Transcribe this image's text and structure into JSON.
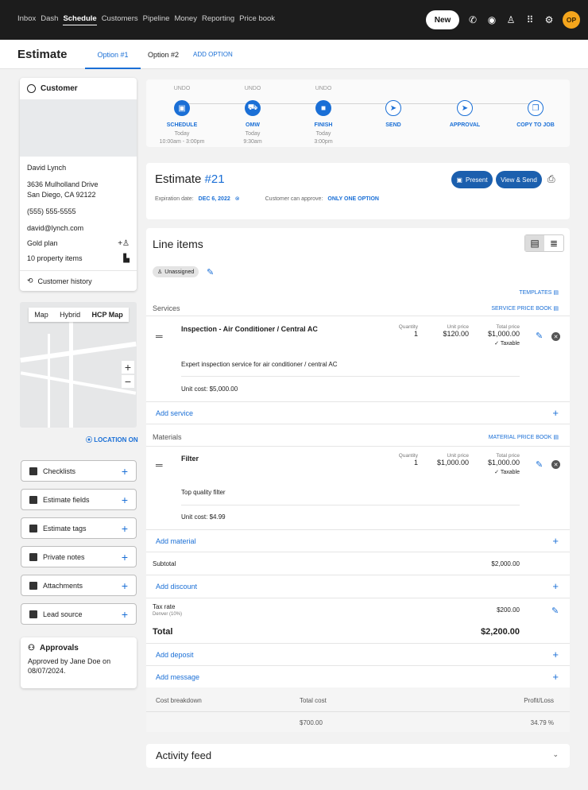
{
  "nav": {
    "links": [
      "Inbox",
      "Dash",
      "Schedule",
      "Customers",
      "Pipeline",
      "Money",
      "Reporting",
      "Price book"
    ],
    "active": "Schedule",
    "new_label": "New",
    "avatar": "OP",
    "icons": [
      "phone-icon",
      "chat-icon",
      "person-icon",
      "apps-grid-icon",
      "gear-icon"
    ]
  },
  "header": {
    "title": "Estimate",
    "tabs": [
      "Option #1",
      "Option #2"
    ],
    "add_option": "ADD OPTION"
  },
  "customer": {
    "heading": "Customer",
    "name": "David Lynch",
    "address1": "3636 Mulholland Drive",
    "address2": "San Diego, CA 92122",
    "phone": "(555) 555-5555",
    "email": "david@lynch.com",
    "plan": "Gold plan",
    "property": "10 property items",
    "history": "Customer history"
  },
  "map": {
    "tabs": [
      "Map",
      "Hybrid",
      "HCP Map"
    ],
    "active": "HCP Map",
    "location_label": "LOCATION ON"
  },
  "sections": [
    "Checklists",
    "Estimate fields",
    "Estimate tags",
    "Private notes",
    "Attachments",
    "Lead source"
  ],
  "approvals": {
    "heading": "Approvals",
    "text": "Approved by Jane Doe on 08/07/2024."
  },
  "workflow": [
    {
      "undo": "UNDO",
      "name": "SCHEDULE",
      "sub1": "Today",
      "sub2": "10:00am - 3:00pm",
      "done": true,
      "icon": "calendar-icon"
    },
    {
      "undo": "UNDO",
      "name": "OMW",
      "sub1": "Today",
      "sub2": "9:30am",
      "done": true,
      "icon": "truck-icon"
    },
    {
      "undo": "UNDO",
      "name": "FINISH",
      "sub1": "Today",
      "sub2": "3:00pm",
      "done": true,
      "icon": "stop-icon"
    },
    {
      "undo": "",
      "name": "SEND",
      "sub1": "",
      "sub2": "",
      "done": false,
      "icon": "send-icon"
    },
    {
      "undo": "",
      "name": "APPROVAL",
      "sub1": "",
      "sub2": "",
      "done": false,
      "icon": "send-icon"
    },
    {
      "undo": "",
      "name": "COPY TO JOB",
      "sub1": "",
      "sub2": "",
      "done": false,
      "icon": "copy-icon"
    }
  ],
  "estimate": {
    "title": "Estimate",
    "number": "#21",
    "expiration_label": "Expiration date:",
    "expiration_value": "DEC 6, 2022",
    "approve_label": "Customer can approve:",
    "approve_value": "ONLY ONE OPTION",
    "present_label": "Present",
    "send_label": "View & Send"
  },
  "line_items": {
    "title": "Line items",
    "assignee": "Unassigned",
    "templates": "TEMPLATES",
    "services_label": "Services",
    "service_pricebook": "SERVICE PRICE BOOK",
    "materials_label": "Materials",
    "material_pricebook": "MATERIAL PRICE BOOK",
    "qty_label": "Quantity",
    "unit_label": "Unit price",
    "total_label": "Total price",
    "taxable_label": "Taxable",
    "service": {
      "name": "Inspection - Air Conditioner / Central AC",
      "qty": "1",
      "unit": "$120.00",
      "total": "$1,000.00",
      "desc": "Expert inspection service for air conditioner / central AC",
      "cost": "Unit cost: $5,000.00"
    },
    "material": {
      "name": "Filter",
      "qty": "1",
      "unit": "$1,000.00",
      "total": "$1,000.00",
      "desc": "Top quality filter",
      "cost": "Unit cost: $4.99"
    },
    "add_service": "Add service",
    "add_material": "Add material",
    "subtotal_label": "Subtotal",
    "subtotal": "$2,000.00",
    "add_discount": "Add discount",
    "tax_label": "Tax rate",
    "tax_sub": "Denver (10%)",
    "tax": "$200.00",
    "total_label2": "Total",
    "total": "$2,200.00",
    "add_deposit": "Add deposit",
    "add_message": "Add message",
    "cost_breakdown": "Cost breakdown",
    "total_cost_label": "Total cost",
    "profit_label": "Profit/Loss",
    "total_cost": "$700.00",
    "profit": "34.79 %"
  },
  "activity": {
    "title": "Activity feed"
  }
}
